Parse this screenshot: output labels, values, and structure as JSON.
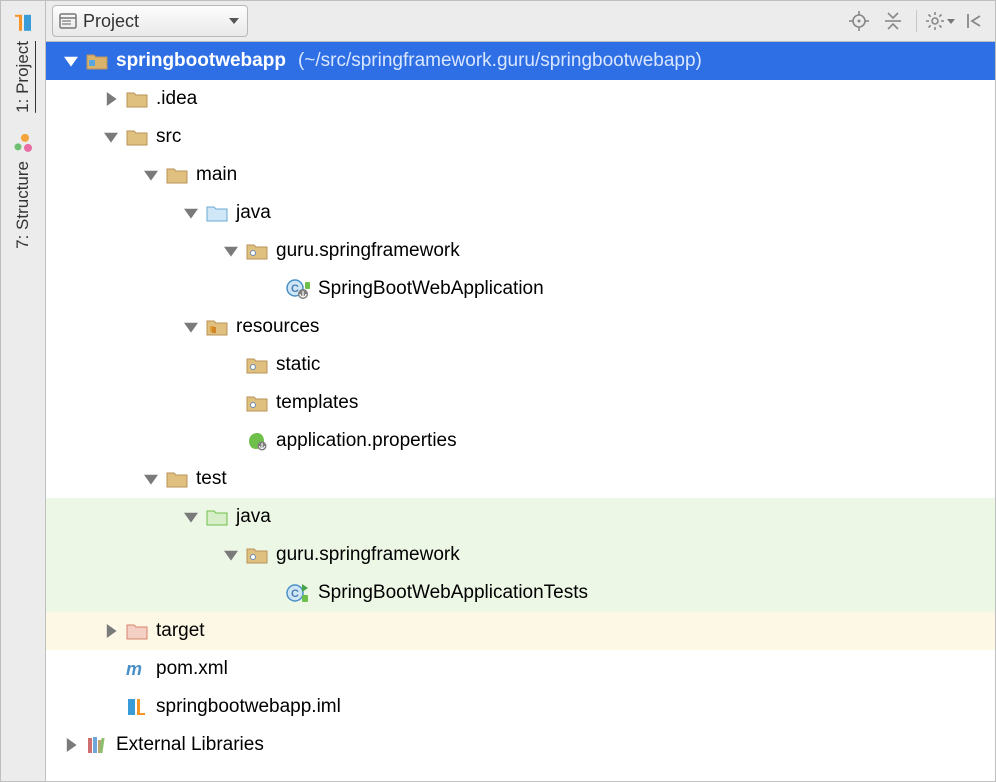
{
  "sidebar": {
    "tabs": [
      {
        "label": "1: Project",
        "active": true
      },
      {
        "label": "7: Structure",
        "active": false
      }
    ]
  },
  "topbar": {
    "view_selector": "Project"
  },
  "tree": {
    "root": {
      "name": "springbootwebapp",
      "path": "(~/src/springframework.guru/springbootwebapp)"
    },
    "nodes": {
      "idea": ".idea",
      "src": "src",
      "main": "main",
      "java": "java",
      "pkg_main": "guru.springframework",
      "main_class": "SpringBootWebApplication",
      "resources": "resources",
      "static": "static",
      "templates": "templates",
      "app_props": "application.properties",
      "test": "test",
      "java_test": "java",
      "pkg_test": "guru.springframework",
      "test_class": "SpringBootWebApplicationTests",
      "target": "target",
      "pom": "pom.xml",
      "iml": "springbootwebapp.iml",
      "ext_libs": "External Libraries"
    }
  }
}
